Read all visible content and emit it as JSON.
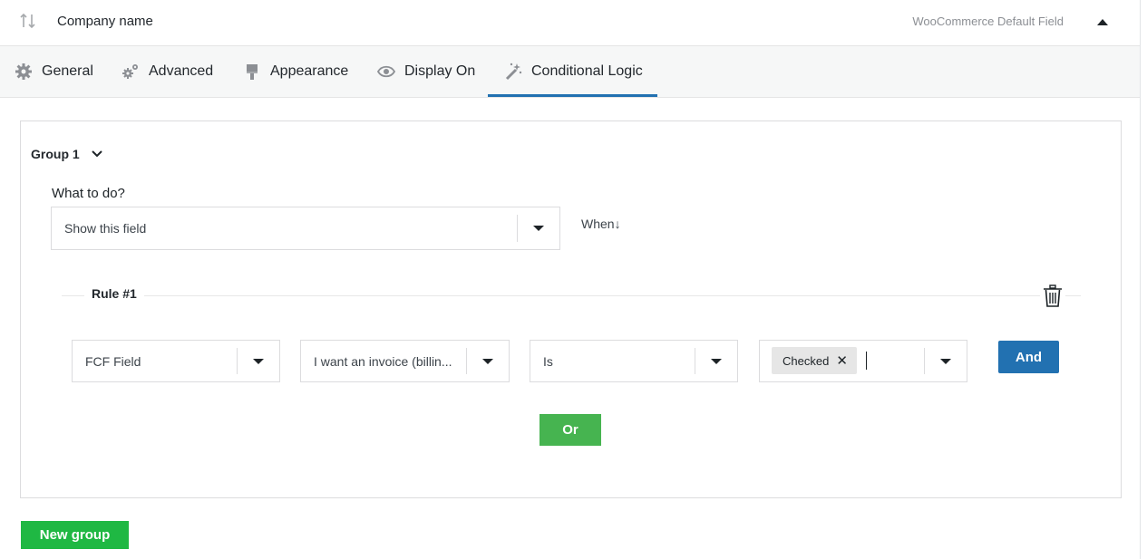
{
  "header": {
    "field_name": "Company name",
    "field_type": "WooCommerce Default Field",
    "sort_icon": "sort-arrows-icon",
    "collapse_icon": "caret-up-icon"
  },
  "tabs": [
    {
      "label": "General",
      "icon": "gear-icon",
      "active": false
    },
    {
      "label": "Advanced",
      "icon": "gears-icon",
      "active": false
    },
    {
      "label": "Appearance",
      "icon": "paintbrush-icon",
      "active": false
    },
    {
      "label": "Display On",
      "icon": "eye-icon",
      "active": false
    },
    {
      "label": "Conditional Logic",
      "icon": "magic-wand-icon",
      "active": true
    }
  ],
  "group": {
    "title": "Group 1",
    "what_to_do_label": "What to do?",
    "action_value": "Show this field",
    "when_label": "When↓",
    "rule": {
      "title": "Rule #1",
      "field_source": "FCF Field",
      "field": "I want an invoice (billin...",
      "operator": "Is",
      "value_tag": "Checked",
      "value_tag_remove": "✕"
    },
    "and_label": "And",
    "or_label": "Or"
  },
  "new_group_label": "New group",
  "colors": {
    "accent": "#2271b1",
    "or_button": "#46b450",
    "new_group_button": "#1fb843"
  }
}
